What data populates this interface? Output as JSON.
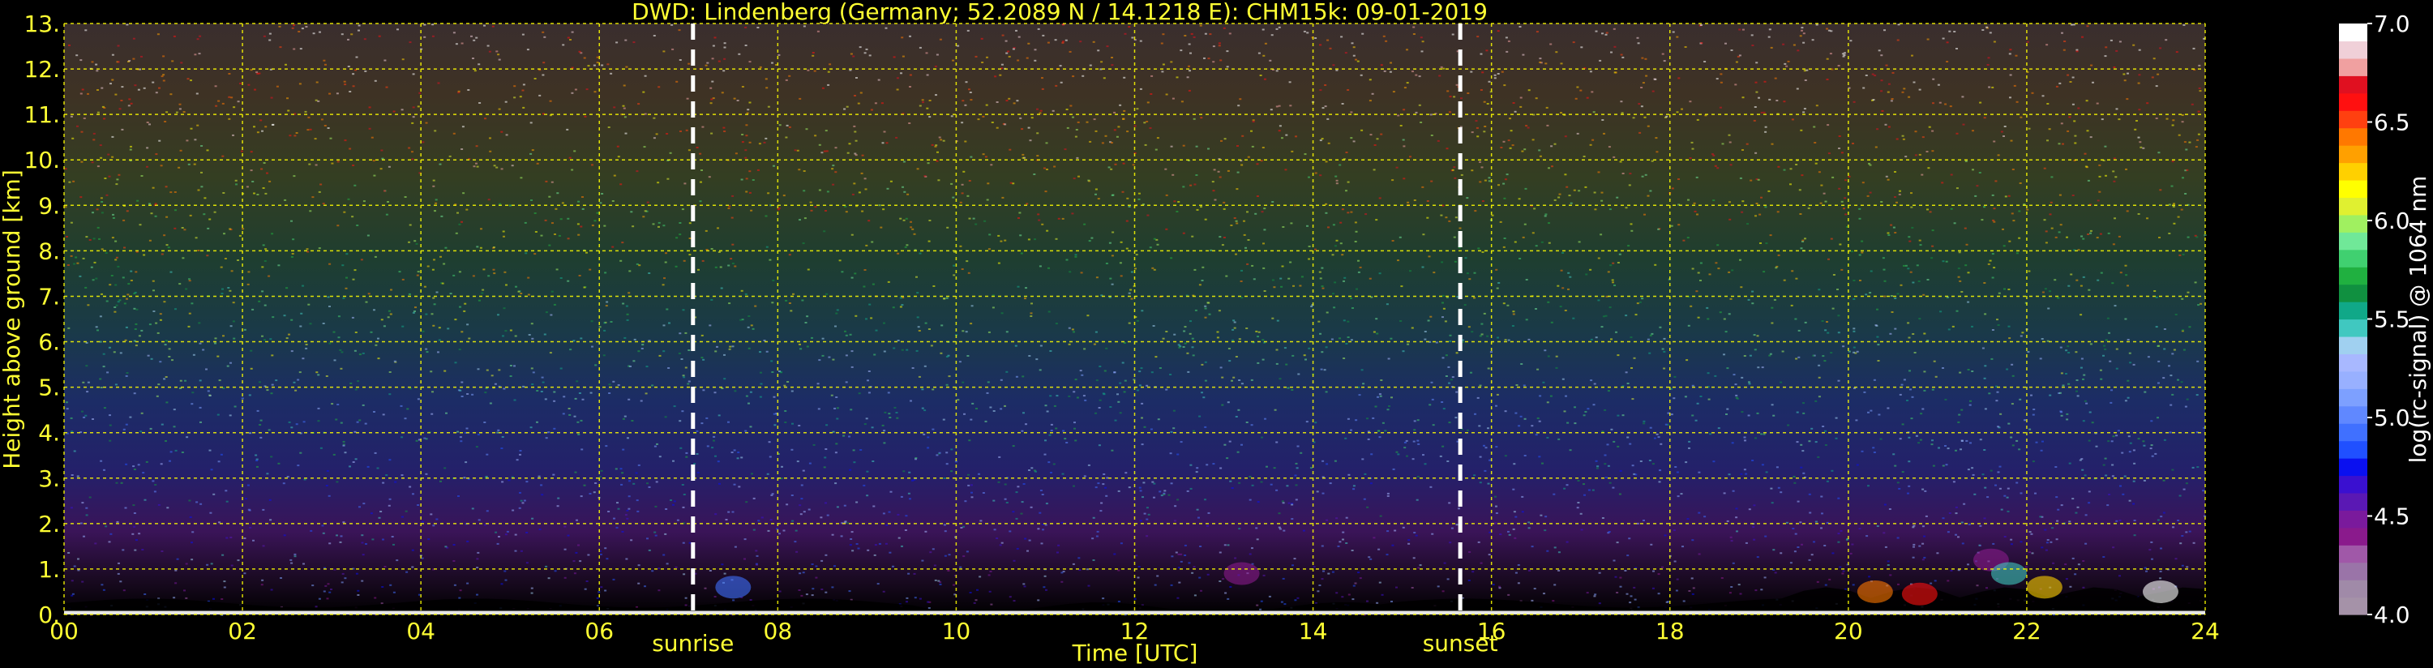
{
  "chart_data": {
    "type": "heatmap",
    "title": "DWD: Lindenberg (Germany; 52.2089 N / 14.1218 E):     CHM15k: 09-01-2019",
    "xlabel": "Time [UTC]",
    "ylabel": "Height above ground [km]",
    "xlim": [
      0,
      24
    ],
    "ylim": [
      0,
      13
    ],
    "x_ticks": [
      "00",
      "02",
      "04",
      "06",
      "08",
      "10",
      "12",
      "14",
      "16",
      "18",
      "20",
      "22",
      "24"
    ],
    "x_tick_values": [
      0,
      2,
      4,
      6,
      8,
      10,
      12,
      14,
      16,
      18,
      20,
      22,
      24
    ],
    "y_ticks": [
      "0.",
      "1.",
      "2.",
      "3.",
      "4.",
      "5.",
      "6.",
      "7.",
      "8.",
      "9.",
      "10.",
      "11.",
      "12.",
      "13."
    ],
    "y_tick_values": [
      0,
      1,
      2,
      3,
      4,
      5,
      6,
      7,
      8,
      9,
      10,
      11,
      12,
      13
    ],
    "grid": true,
    "grid_color": "#ffff00",
    "markers": [
      {
        "label": "sunrise",
        "x": 7.05
      },
      {
        "label": "sunset",
        "x": 15.65
      }
    ],
    "colorbar": {
      "label": "log(rc-signal) @ 1064 nm",
      "range": [
        4.0,
        7.0
      ],
      "ticks": [
        "4.0",
        "4.5",
        "5.0",
        "5.5",
        "6.0",
        "6.5",
        "7.0"
      ],
      "tick_values": [
        4.0,
        4.5,
        5.0,
        5.5,
        6.0,
        6.5,
        7.0
      ],
      "colors": [
        "#a592a8",
        "#a08aa8",
        "#9a74a8",
        "#a058a8",
        "#8a1a8c",
        "#7a1a9c",
        "#5a18b4",
        "#3a10d0",
        "#0a10f0",
        "#2050ff",
        "#4070ff",
        "#6088ff",
        "#7da0ff",
        "#98b0ff",
        "#a8b8ff",
        "#a0d0f0",
        "#40c8c0",
        "#10a888",
        "#109040",
        "#20b040",
        "#40d070",
        "#70e898",
        "#a0f060",
        "#e0f030",
        "#ffff00",
        "#ffd000",
        "#ffa000",
        "#ff7800",
        "#ff4010",
        "#ff1010",
        "#e01020",
        "#f0a0a0",
        "#f0d0d8",
        "#ffffff"
      ]
    }
  }
}
